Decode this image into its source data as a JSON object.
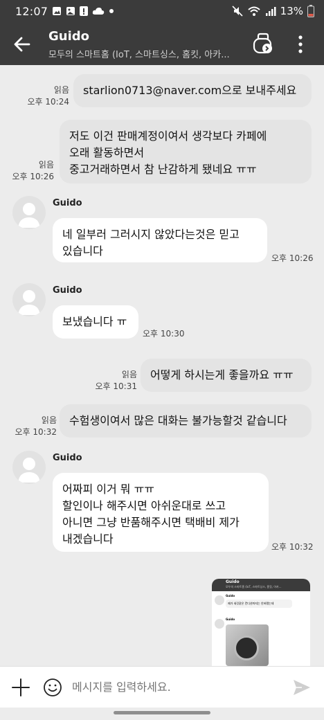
{
  "status_bar": {
    "time": "12:07",
    "battery": "13%",
    "icons_left": [
      "image-icon",
      "gallery-icon",
      "alert-icon",
      "cloud-icon",
      "dot-icon"
    ],
    "icons_right": [
      "mute-icon",
      "wifi-icon",
      "signal-icon",
      "battery-icon"
    ]
  },
  "header": {
    "title": "Guido",
    "subtitle": "모두의 스마트홈 (IoT, 스마트싱스, 홈킷, 아카...",
    "back_icon": "arrow-left-icon",
    "share_icon": "share-chat-icon",
    "more_icon": "more-vertical-icon"
  },
  "messages": [
    {
      "id": "m1",
      "direction": "sent",
      "read": "읽음",
      "time": "오후 10:24",
      "text": "starlion0713@naver.com으로 보내주세요"
    },
    {
      "id": "m2",
      "direction": "sent",
      "read": "읽음",
      "time": "오후 10:26",
      "text": "저도 이건 판매계정이여서 생각보다 카페에\n오래 활동하면서\n중고거래하면서 참 난감하게 됐네요 ㅠㅠ"
    },
    {
      "id": "m3",
      "direction": "received",
      "sender": "Guido",
      "time": "오후 10:26",
      "text": "네 일부러 그러시지 않았다는것은 믿고\n있습니다"
    },
    {
      "id": "m4",
      "direction": "received",
      "sender": "Guido",
      "time": "오후 10:30",
      "text": "보냈습니다 ㅠ"
    },
    {
      "id": "m5",
      "direction": "sent",
      "read": "읽음",
      "time": "오후 10:31",
      "text": "어떻게 하시는게 좋을까요 ㅠㅠ"
    },
    {
      "id": "m6",
      "direction": "sent",
      "read": "읽음",
      "time": "오후 10:32",
      "text": "수험생이여서 많은 대화는 불가능할것 같습니다"
    },
    {
      "id": "m7",
      "direction": "received",
      "sender": "Guido",
      "time": "오후 10:32",
      "text": "어짜피 이거 뭐 ㅠㅠ\n할인이나 해주시면 아쉬운대로 쓰고\n아니면 그냥 반품해주시면 택배비 제가\n내겠습니다"
    }
  ],
  "screenshot_preview": {
    "title": "Guido",
    "subtitle": "모두의 스마트홈 (IoT, 스마트싱스, 홈킷, 아카...",
    "sender": "Guido",
    "msg": "제가 새것같은 컨디션까지는 안바랬는데",
    "sender2": "Guido"
  },
  "input": {
    "placeholder": "메시지를 입력하세요.",
    "plus_icon": "plus-icon",
    "emoji_icon": "emoji-icon",
    "send_icon": "send-icon"
  },
  "colors": {
    "header_bg": "#3b3b3b",
    "chat_bg": "#ececec",
    "bubble_bg": "#ffffff"
  }
}
